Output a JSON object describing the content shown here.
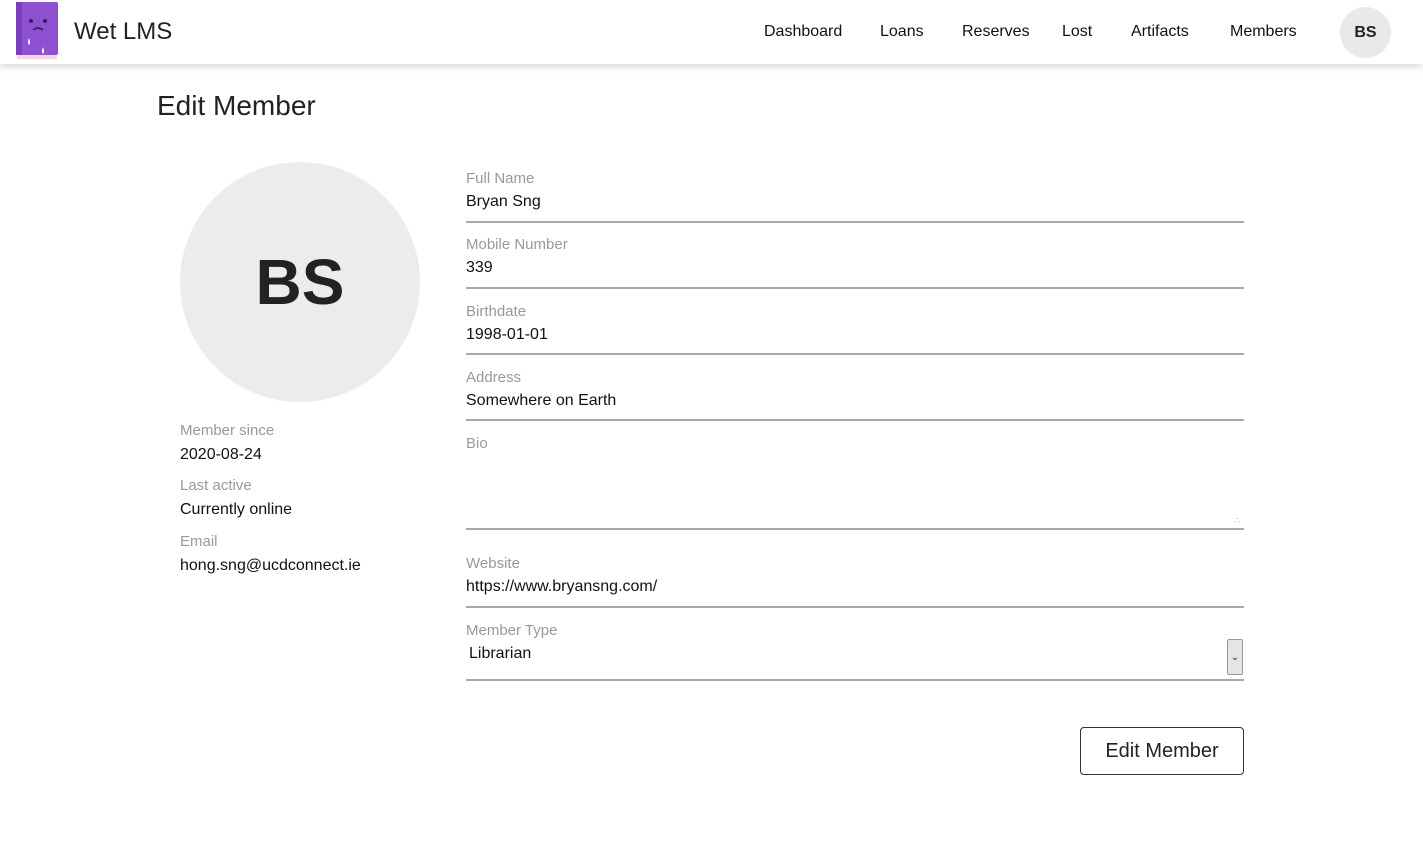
{
  "app": {
    "title": "Wet LMS"
  },
  "nav": {
    "items": [
      "Dashboard",
      "Loans",
      "Reserves",
      "Lost",
      "Artifacts",
      "Members"
    ],
    "avatar_initials": "BS"
  },
  "page": {
    "title": "Edit Member"
  },
  "profile": {
    "initials": "BS",
    "member_since_label": "Member since",
    "member_since": "2020-08-24",
    "last_active_label": "Last active",
    "last_active": "Currently online",
    "email_label": "Email",
    "email": "hong.sng@ucdconnect.ie"
  },
  "form": {
    "full_name": {
      "label": "Full Name",
      "value": "Bryan Sng"
    },
    "mobile": {
      "label": "Mobile Number",
      "value": "339"
    },
    "birthdate": {
      "label": "Birthdate",
      "value": "1998-01-01"
    },
    "address": {
      "label": "Address",
      "value": "Somewhere on Earth"
    },
    "bio": {
      "label": "Bio",
      "value": ""
    },
    "website": {
      "label": "Website",
      "value": "https://www.bryansng.com/"
    },
    "member_type": {
      "label": "Member Type",
      "value": "Librarian"
    },
    "submit_label": "Edit Member"
  },
  "colors": {
    "logo": "#8e4fd1",
    "muted_text": "#999999",
    "avatar_bg": "#ececec"
  }
}
